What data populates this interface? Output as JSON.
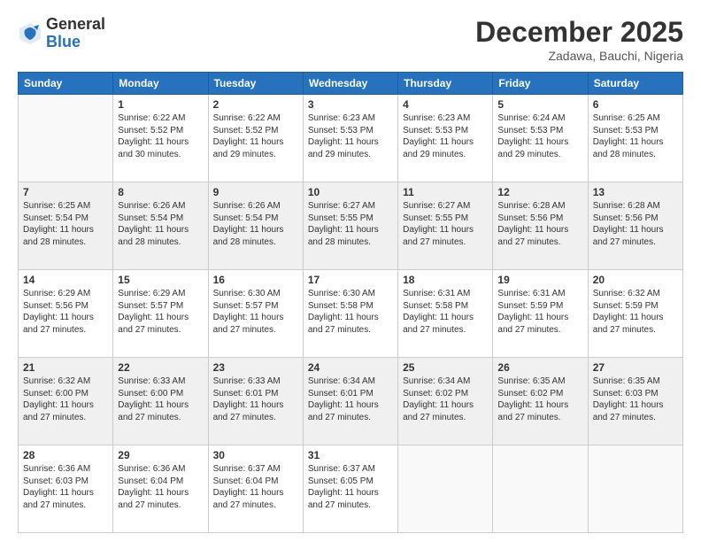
{
  "header": {
    "logo_general": "General",
    "logo_blue": "Blue",
    "month_title": "December 2025",
    "location": "Zadawa, Bauchi, Nigeria"
  },
  "weekdays": [
    "Sunday",
    "Monday",
    "Tuesday",
    "Wednesday",
    "Thursday",
    "Friday",
    "Saturday"
  ],
  "rows": [
    {
      "shaded": false,
      "cells": [
        {
          "day": "",
          "empty": true
        },
        {
          "day": "1",
          "line1": "Sunrise: 6:22 AM",
          "line2": "Sunset: 5:52 PM",
          "line3": "Daylight: 11 hours",
          "line4": "and 30 minutes."
        },
        {
          "day": "2",
          "line1": "Sunrise: 6:22 AM",
          "line2": "Sunset: 5:52 PM",
          "line3": "Daylight: 11 hours",
          "line4": "and 29 minutes."
        },
        {
          "day": "3",
          "line1": "Sunrise: 6:23 AM",
          "line2": "Sunset: 5:53 PM",
          "line3": "Daylight: 11 hours",
          "line4": "and 29 minutes."
        },
        {
          "day": "4",
          "line1": "Sunrise: 6:23 AM",
          "line2": "Sunset: 5:53 PM",
          "line3": "Daylight: 11 hours",
          "line4": "and 29 minutes."
        },
        {
          "day": "5",
          "line1": "Sunrise: 6:24 AM",
          "line2": "Sunset: 5:53 PM",
          "line3": "Daylight: 11 hours",
          "line4": "and 29 minutes."
        },
        {
          "day": "6",
          "line1": "Sunrise: 6:25 AM",
          "line2": "Sunset: 5:53 PM",
          "line3": "Daylight: 11 hours",
          "line4": "and 28 minutes."
        }
      ]
    },
    {
      "shaded": true,
      "cells": [
        {
          "day": "7",
          "line1": "Sunrise: 6:25 AM",
          "line2": "Sunset: 5:54 PM",
          "line3": "Daylight: 11 hours",
          "line4": "and 28 minutes."
        },
        {
          "day": "8",
          "line1": "Sunrise: 6:26 AM",
          "line2": "Sunset: 5:54 PM",
          "line3": "Daylight: 11 hours",
          "line4": "and 28 minutes."
        },
        {
          "day": "9",
          "line1": "Sunrise: 6:26 AM",
          "line2": "Sunset: 5:54 PM",
          "line3": "Daylight: 11 hours",
          "line4": "and 28 minutes."
        },
        {
          "day": "10",
          "line1": "Sunrise: 6:27 AM",
          "line2": "Sunset: 5:55 PM",
          "line3": "Daylight: 11 hours",
          "line4": "and 28 minutes."
        },
        {
          "day": "11",
          "line1": "Sunrise: 6:27 AM",
          "line2": "Sunset: 5:55 PM",
          "line3": "Daylight: 11 hours",
          "line4": "and 27 minutes."
        },
        {
          "day": "12",
          "line1": "Sunrise: 6:28 AM",
          "line2": "Sunset: 5:56 PM",
          "line3": "Daylight: 11 hours",
          "line4": "and 27 minutes."
        },
        {
          "day": "13",
          "line1": "Sunrise: 6:28 AM",
          "line2": "Sunset: 5:56 PM",
          "line3": "Daylight: 11 hours",
          "line4": "and 27 minutes."
        }
      ]
    },
    {
      "shaded": false,
      "cells": [
        {
          "day": "14",
          "line1": "Sunrise: 6:29 AM",
          "line2": "Sunset: 5:56 PM",
          "line3": "Daylight: 11 hours",
          "line4": "and 27 minutes."
        },
        {
          "day": "15",
          "line1": "Sunrise: 6:29 AM",
          "line2": "Sunset: 5:57 PM",
          "line3": "Daylight: 11 hours",
          "line4": "and 27 minutes."
        },
        {
          "day": "16",
          "line1": "Sunrise: 6:30 AM",
          "line2": "Sunset: 5:57 PM",
          "line3": "Daylight: 11 hours",
          "line4": "and 27 minutes."
        },
        {
          "day": "17",
          "line1": "Sunrise: 6:30 AM",
          "line2": "Sunset: 5:58 PM",
          "line3": "Daylight: 11 hours",
          "line4": "and 27 minutes."
        },
        {
          "day": "18",
          "line1": "Sunrise: 6:31 AM",
          "line2": "Sunset: 5:58 PM",
          "line3": "Daylight: 11 hours",
          "line4": "and 27 minutes."
        },
        {
          "day": "19",
          "line1": "Sunrise: 6:31 AM",
          "line2": "Sunset: 5:59 PM",
          "line3": "Daylight: 11 hours",
          "line4": "and 27 minutes."
        },
        {
          "day": "20",
          "line1": "Sunrise: 6:32 AM",
          "line2": "Sunset: 5:59 PM",
          "line3": "Daylight: 11 hours",
          "line4": "and 27 minutes."
        }
      ]
    },
    {
      "shaded": true,
      "cells": [
        {
          "day": "21",
          "line1": "Sunrise: 6:32 AM",
          "line2": "Sunset: 6:00 PM",
          "line3": "Daylight: 11 hours",
          "line4": "and 27 minutes."
        },
        {
          "day": "22",
          "line1": "Sunrise: 6:33 AM",
          "line2": "Sunset: 6:00 PM",
          "line3": "Daylight: 11 hours",
          "line4": "and 27 minutes."
        },
        {
          "day": "23",
          "line1": "Sunrise: 6:33 AM",
          "line2": "Sunset: 6:01 PM",
          "line3": "Daylight: 11 hours",
          "line4": "and 27 minutes."
        },
        {
          "day": "24",
          "line1": "Sunrise: 6:34 AM",
          "line2": "Sunset: 6:01 PM",
          "line3": "Daylight: 11 hours",
          "line4": "and 27 minutes."
        },
        {
          "day": "25",
          "line1": "Sunrise: 6:34 AM",
          "line2": "Sunset: 6:02 PM",
          "line3": "Daylight: 11 hours",
          "line4": "and 27 minutes."
        },
        {
          "day": "26",
          "line1": "Sunrise: 6:35 AM",
          "line2": "Sunset: 6:02 PM",
          "line3": "Daylight: 11 hours",
          "line4": "and 27 minutes."
        },
        {
          "day": "27",
          "line1": "Sunrise: 6:35 AM",
          "line2": "Sunset: 6:03 PM",
          "line3": "Daylight: 11 hours",
          "line4": "and 27 minutes."
        }
      ]
    },
    {
      "shaded": false,
      "cells": [
        {
          "day": "28",
          "line1": "Sunrise: 6:36 AM",
          "line2": "Sunset: 6:03 PM",
          "line3": "Daylight: 11 hours",
          "line4": "and 27 minutes."
        },
        {
          "day": "29",
          "line1": "Sunrise: 6:36 AM",
          "line2": "Sunset: 6:04 PM",
          "line3": "Daylight: 11 hours",
          "line4": "and 27 minutes."
        },
        {
          "day": "30",
          "line1": "Sunrise: 6:37 AM",
          "line2": "Sunset: 6:04 PM",
          "line3": "Daylight: 11 hours",
          "line4": "and 27 minutes."
        },
        {
          "day": "31",
          "line1": "Sunrise: 6:37 AM",
          "line2": "Sunset: 6:05 PM",
          "line3": "Daylight: 11 hours",
          "line4": "and 27 minutes."
        },
        {
          "day": "",
          "empty": true
        },
        {
          "day": "",
          "empty": true
        },
        {
          "day": "",
          "empty": true
        }
      ]
    }
  ]
}
